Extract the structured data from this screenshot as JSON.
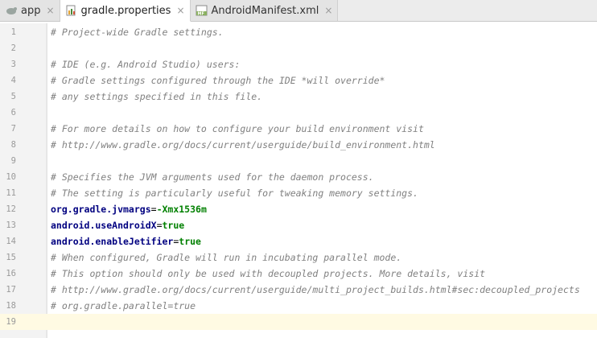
{
  "tabs": [
    {
      "label": "app",
      "icon": "module-icon",
      "active": false,
      "close": "×"
    },
    {
      "label": "gradle.properties",
      "icon": "properties-file-icon",
      "active": true,
      "close": "×"
    },
    {
      "label": "AndroidManifest.xml",
      "icon": "manifest-file-icon",
      "active": false,
      "close": "×",
      "icon_text": "MF"
    }
  ],
  "lines": [
    {
      "n": "1",
      "type": "comment",
      "text": "# Project-wide Gradle settings."
    },
    {
      "n": "2",
      "type": "empty",
      "text": ""
    },
    {
      "n": "3",
      "type": "comment",
      "text": "# IDE (e.g. Android Studio) users:"
    },
    {
      "n": "4",
      "type": "comment",
      "text": "# Gradle settings configured through the IDE *will override*"
    },
    {
      "n": "5",
      "type": "comment",
      "text": "# any settings specified in this file."
    },
    {
      "n": "6",
      "type": "empty",
      "text": ""
    },
    {
      "n": "7",
      "type": "comment",
      "text": "# For more details on how to configure your build environment visit"
    },
    {
      "n": "8",
      "type": "comment",
      "text": "# http://www.gradle.org/docs/current/userguide/build_environment.html"
    },
    {
      "n": "9",
      "type": "empty",
      "text": ""
    },
    {
      "n": "10",
      "type": "comment",
      "text": "# Specifies the JVM arguments used for the daemon process."
    },
    {
      "n": "11",
      "type": "comment",
      "text": "# The setting is particularly useful for tweaking memory settings."
    },
    {
      "n": "12",
      "type": "property",
      "key": "org.gradle.jvmargs",
      "eq": "=",
      "value": "-Xmx1536m"
    },
    {
      "n": "13",
      "type": "property",
      "key": "android.useAndroidX",
      "eq": "=",
      "value": "true"
    },
    {
      "n": "14",
      "type": "property",
      "key": "android.enableJetifier",
      "eq": "=",
      "value": "true"
    },
    {
      "n": "15",
      "type": "comment",
      "text": "# When configured, Gradle will run in incubating parallel mode."
    },
    {
      "n": "16",
      "type": "comment",
      "text": "# This option should only be used with decoupled projects. More details, visit"
    },
    {
      "n": "17",
      "type": "comment",
      "text": "# http://www.gradle.org/docs/current/userguide/multi_project_builds.html#sec:decoupled_projects"
    },
    {
      "n": "18",
      "type": "comment",
      "text": "# org.gradle.parallel=true"
    },
    {
      "n": "19",
      "type": "empty",
      "text": "",
      "current": true
    }
  ],
  "colors": {
    "comment": "#808080",
    "key": "#000080",
    "value": "#008000",
    "current_line": "#fffae3"
  }
}
